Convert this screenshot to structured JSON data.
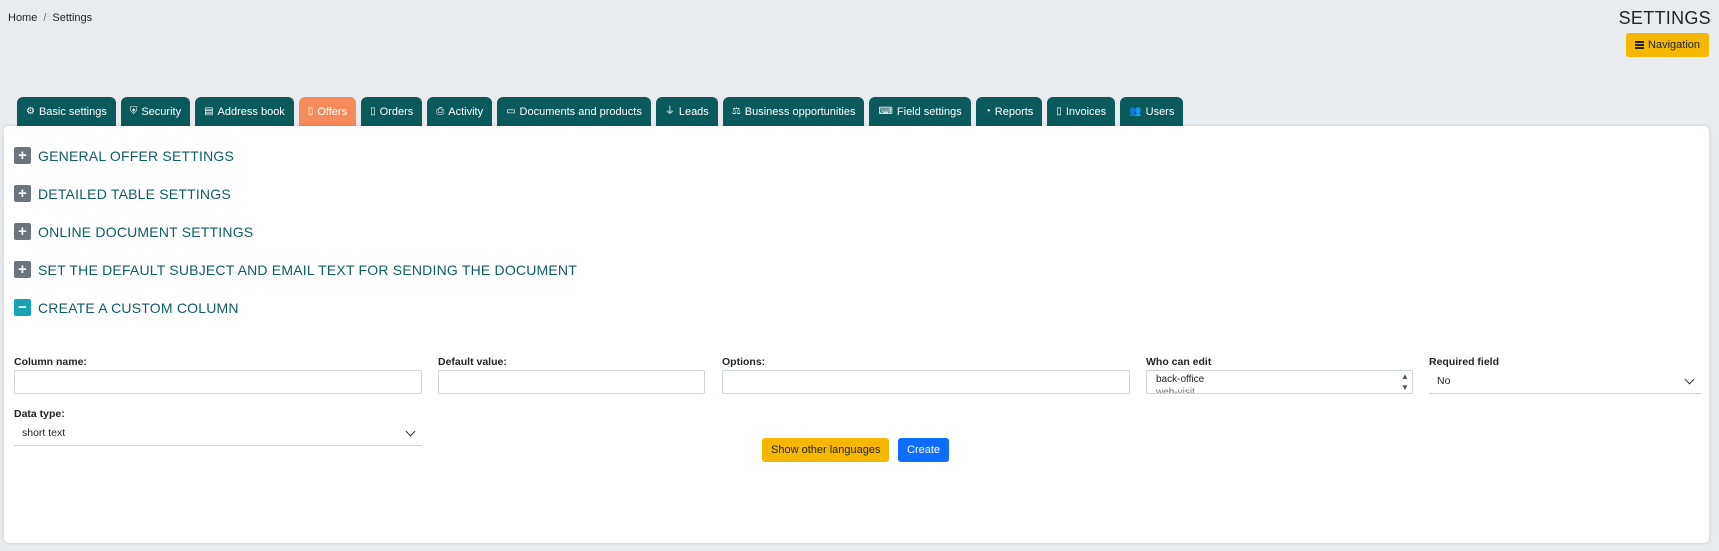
{
  "breadcrumb": {
    "home": "Home",
    "sep": "/",
    "current": "Settings"
  },
  "header": {
    "title": "SETTINGS",
    "navigation_label": "Navigation"
  },
  "tabs": [
    {
      "label": "Basic settings",
      "icon": "⚙"
    },
    {
      "label": "Security",
      "icon": "⛨"
    },
    {
      "label": "Address book",
      "icon": "▤"
    },
    {
      "label": "Offers",
      "icon": "▯"
    },
    {
      "label": "Orders",
      "icon": "▯"
    },
    {
      "label": "Activity",
      "icon": "⎙"
    },
    {
      "label": "Documents and products",
      "icon": "▭"
    },
    {
      "label": "Leads",
      "icon": "⏚"
    },
    {
      "label": "Business opportunities",
      "icon": "⚖"
    },
    {
      "label": "Field settings",
      "icon": "⌨"
    },
    {
      "label": "Reports",
      "icon": "◔"
    },
    {
      "label": "Invoices",
      "icon": "▯"
    },
    {
      "label": "Users",
      "icon": "👥"
    }
  ],
  "sections": [
    {
      "label": "GENERAL OFFER SETTINGS",
      "toggle": "+"
    },
    {
      "label": "DETAILED TABLE SETTINGS",
      "toggle": "+"
    },
    {
      "label": "ONLINE DOCUMENT SETTINGS",
      "toggle": "+"
    },
    {
      "label": "SET THE DEFAULT SUBJECT AND EMAIL TEXT FOR SENDING THE DOCUMENT",
      "toggle": "+"
    },
    {
      "label": "CREATE A CUSTOM COLUMN",
      "toggle": "−"
    }
  ],
  "form": {
    "column_name_label": "Column name:",
    "default_value_label": "Default value:",
    "options_label": "Options:",
    "who_can_edit_label": "Who can edit",
    "who_can_edit_options": [
      "back-office",
      "web-visit"
    ],
    "required_label": "Required field",
    "required_value": "No",
    "data_type_label": "Data type:",
    "data_type_value": "short text"
  },
  "buttons": {
    "show_languages": "Show other languages",
    "create": "Create"
  },
  "colors": {
    "tab": "#0a5a5c",
    "tab_active": "#f58a5a",
    "accent_yellow": "#f5b800",
    "primary_blue": "#0d6efd",
    "section_text": "#0d5d63"
  }
}
